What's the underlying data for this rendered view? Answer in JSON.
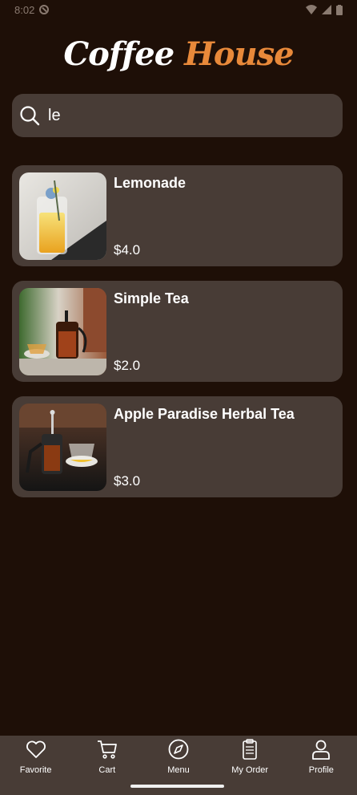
{
  "status_bar": {
    "time": "8:02"
  },
  "app": {
    "title_part1": "Coffee ",
    "title_part2": "House"
  },
  "search": {
    "value": "le",
    "icon": "search-icon"
  },
  "products": [
    {
      "name": "Lemonade",
      "price": "$4.0",
      "image": "lemonade-photo"
    },
    {
      "name": "Simple Tea",
      "price": "$2.0",
      "image": "simple-tea-photo"
    },
    {
      "name": "Apple Paradise Herbal Tea",
      "price": "$3.0",
      "image": "herbal-tea-photo"
    }
  ],
  "bottom_nav": [
    {
      "label": "Favorite",
      "icon": "heart-icon"
    },
    {
      "label": "Cart",
      "icon": "cart-icon"
    },
    {
      "label": "Menu",
      "icon": "compass-icon"
    },
    {
      "label": "My Order",
      "icon": "receipt-icon"
    },
    {
      "label": "Profile",
      "icon": "user-icon"
    }
  ],
  "colors": {
    "background": "#1e0f07",
    "card": "#483c36",
    "accent": "#e8893a"
  }
}
